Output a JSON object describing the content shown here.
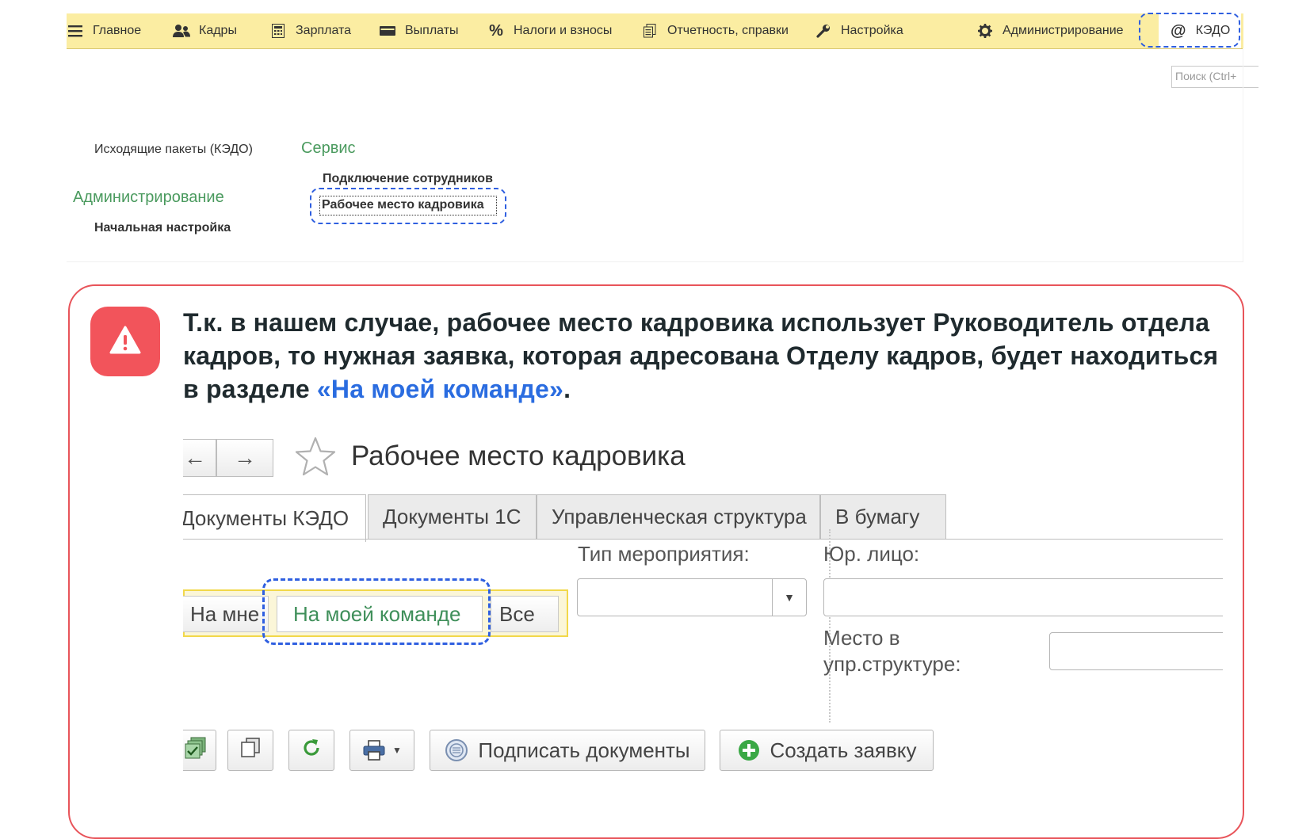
{
  "menu": {
    "items": [
      {
        "label": "Главное",
        "icon": "menu-icon"
      },
      {
        "label": "Кадры",
        "icon": "people-icon"
      },
      {
        "label": "Зарплата",
        "icon": "calculator-icon"
      },
      {
        "label": "Выплаты",
        "icon": "wallet-icon"
      },
      {
        "label": "Налоги и взносы",
        "icon": "percent-icon"
      },
      {
        "label": "Отчетность, справки",
        "icon": "documents-icon"
      },
      {
        "label": "Настройка",
        "icon": "wrench-icon"
      },
      {
        "label": "Администрирование",
        "icon": "gear-icon"
      },
      {
        "label": "КЭДО",
        "icon": "at-icon"
      }
    ],
    "search_placeholder": "Поиск (Ctrl+"
  },
  "section": {
    "outgoing_packages": "Исходящие пакеты (КЭДО)",
    "admin_title": "Администрирование",
    "initial_setup": "Начальная настройка",
    "service_title": "Сервис",
    "connect_employees": "Подключение сотрудников",
    "hr_workstation": "Рабочее место кадровика"
  },
  "note": {
    "icon": "warning-icon",
    "accent_color": "#f2545b",
    "text_before": "Т.к. в нашем случае, рабочее место кадровика использует Руководитель отдела кадров, то нужная заявка, которая адресована Отделу кадров, будет находиться в разделе ",
    "text_highlight": "«На моей команде»",
    "text_after": "."
  },
  "form": {
    "title": "Рабочее место кадровика",
    "tabs": [
      "Документы КЭДО",
      "Документы 1С",
      "Управленческая структура",
      "В бумагу"
    ],
    "filters": [
      "На мне",
      "На моей команде",
      "Все"
    ],
    "event_type_label": "Тип мероприятия:",
    "event_type_value": "",
    "legal_entity_label": "Юр. лицо:",
    "legal_entity_value": "",
    "structure_label_line1": "Место в",
    "structure_label_line2": "упр.структуре:",
    "structure_value": "",
    "toolbar": {
      "sign_documents": "Подписать документы",
      "create_request": "Создать заявку"
    }
  }
}
